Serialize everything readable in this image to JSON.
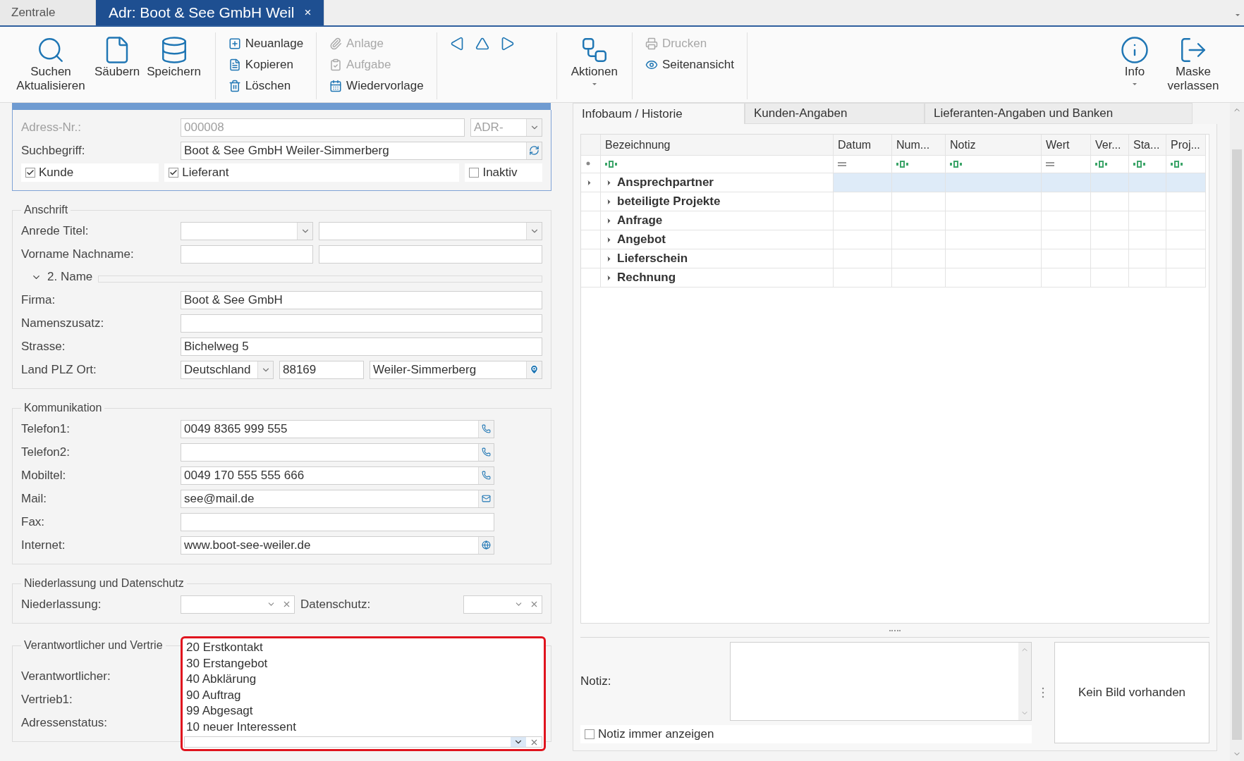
{
  "tabs": [
    {
      "label": "Zentrale",
      "selected": false
    },
    {
      "label": "Adr: Boot & See GmbH Weil",
      "selected": true,
      "close": "×"
    }
  ],
  "toolbar": {
    "groups": [
      {
        "kind": "large",
        "items": [
          {
            "label": "Suchen Aktualisieren",
            "dropdown": false
          },
          {
            "label": "Säubern",
            "dropdown": false
          },
          {
            "label": "Speichern",
            "dropdown": false
          }
        ]
      },
      {
        "kind": "small",
        "items": [
          {
            "label": "Neuanlage",
            "disabled": false
          },
          {
            "label": "Kopieren",
            "disabled": false
          },
          {
            "label": "Löschen",
            "disabled": false
          }
        ]
      },
      {
        "kind": "small",
        "items": [
          {
            "label": "Anlage",
            "disabled": true
          },
          {
            "label": "Aufgabe",
            "disabled": true
          },
          {
            "label": "Wiedervorlage",
            "disabled": false
          }
        ]
      },
      {
        "kind": "nav"
      },
      {
        "kind": "large",
        "items": [
          {
            "label": "Aktionen",
            "dropdown": true
          }
        ]
      },
      {
        "kind": "small",
        "items": [
          {
            "label": "Drucken",
            "disabled": true
          },
          {
            "label": "Seitenansicht",
            "disabled": false
          }
        ]
      }
    ],
    "right_items": [
      {
        "label": "Info",
        "dropdown": true
      },
      {
        "label": "Maske verlassen",
        "dropdown": false
      }
    ]
  },
  "header": {
    "adress_nr": {
      "label": "Adress-Nr.:",
      "value": "000008",
      "prefix": "ADR-",
      "disabled": true
    },
    "suchbegriff": {
      "label": "Suchbegriff:",
      "value": "Boot & See GmbH Weiler-Simmerberg"
    },
    "checkboxes": [
      {
        "label": "Kunde",
        "checked": true
      },
      {
        "label": "Lieferant",
        "checked": true
      },
      {
        "label": "Inaktiv",
        "checked": false
      }
    ]
  },
  "anschrift": {
    "title": "Anschrift",
    "anrede_label": "Anrede Titel:",
    "name_label": "Vorname Nachname:",
    "second_name": {
      "label": "2. Name",
      "expanded": true
    },
    "fields": [
      {
        "label": "Firma:",
        "value": "Boot & See GmbH"
      },
      {
        "label": "Namenszusatz:"
      },
      {
        "label": "Strasse:",
        "value": "Bichelweg 5"
      }
    ],
    "land_plz_ort": {
      "label": "Land PLZ Ort:",
      "country": "Deutschland",
      "zip": "88169",
      "city": "Weiler-Simmerberg"
    }
  },
  "kommunikation": {
    "title": "Kommunikation",
    "fields": [
      {
        "label": "Telefon1:",
        "value": "0049 8365 999 555",
        "kind": "phone"
      },
      {
        "label": "Telefon2:",
        "kind": "phone"
      },
      {
        "label": "Mobiltel:",
        "value": "0049 170 555 555 666",
        "kind": "phone"
      },
      {
        "label": "Mail:",
        "value": "see@mail.de",
        "kind": "mail"
      },
      {
        "label": "Fax:",
        "kind": "plain"
      },
      {
        "label": "Internet:",
        "value": "www.boot-see-weiler.de",
        "kind": "web"
      }
    ]
  },
  "niederlassung": {
    "title": "Niederlassung und Datenschutz",
    "niederlassung_label": "Niederlassung:",
    "datenschutz_label": "Datenschutz:"
  },
  "verantwortlicher": {
    "title": "Verantwortlicher und Vertrie",
    "labels": [
      "Verantwortlicher:",
      "Vertrieb1:",
      "Adressenstatus:"
    ],
    "status_dropdown": {
      "expanded": true,
      "options": [
        "20 Erstkontakt",
        "30 Erstangebot",
        "40 Abklärung",
        "90 Auftrag",
        "99 Abgesagt",
        "10 neuer Interessent"
      ]
    }
  },
  "detail_tabs": [
    {
      "label": "Infobaum / Historie",
      "selected": true
    },
    {
      "label": "Kunden-Angaben",
      "selected": false
    },
    {
      "label": "Lieferanten-Angaben und Banken",
      "selected": false
    }
  ],
  "grid": {
    "columns": [
      {
        "label": "Bezeichnung",
        "kind": "text"
      },
      {
        "label": "Datum",
        "kind": "equals"
      },
      {
        "label": "Num...",
        "kind": "text"
      },
      {
        "label": "Notiz",
        "kind": "text"
      },
      {
        "label": "Wert",
        "kind": "equals"
      },
      {
        "label": "Ver...",
        "kind": "text"
      },
      {
        "label": "Sta...",
        "kind": "text"
      },
      {
        "label": "Proj...",
        "kind": "text"
      }
    ],
    "rows": [
      {
        "label": "Ansprechpartner",
        "selected": true,
        "expanded": false
      },
      {
        "label": "beteiligte Projekte",
        "selected": false,
        "expanded": false
      },
      {
        "label": "Anfrage",
        "selected": false,
        "expanded": false
      },
      {
        "label": "Angebot",
        "selected": false,
        "expanded": false
      },
      {
        "label": "Lieferschein",
        "selected": false,
        "expanded": false
      },
      {
        "label": "Rechnung",
        "selected": false,
        "expanded": false
      }
    ]
  },
  "notiz": {
    "label": "Notiz:",
    "always_show": {
      "label": "Notiz immer anzeigen",
      "checked": false
    }
  },
  "image_box": {
    "text": "Kein Bild vorhanden"
  }
}
